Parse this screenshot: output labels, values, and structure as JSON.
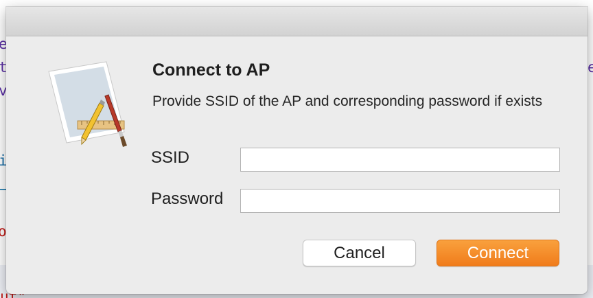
{
  "background": {
    "fragments": [
      "e",
      "t",
      "v",
      "i",
      "o",
      "e",
      "ut\""
    ]
  },
  "dialog": {
    "title": "Connect to AP",
    "message": "Provide SSID of the AP and corresponding password if exists",
    "icon": "app-icon-pencil-ruler-brush",
    "fields": {
      "ssid": {
        "label": "SSID",
        "value": "",
        "placeholder": ""
      },
      "password": {
        "label": "Password",
        "value": "",
        "placeholder": ""
      }
    },
    "buttons": {
      "cancel_label": "Cancel",
      "connect_label": "Connect"
    },
    "accent_color": "#f28a2a"
  }
}
